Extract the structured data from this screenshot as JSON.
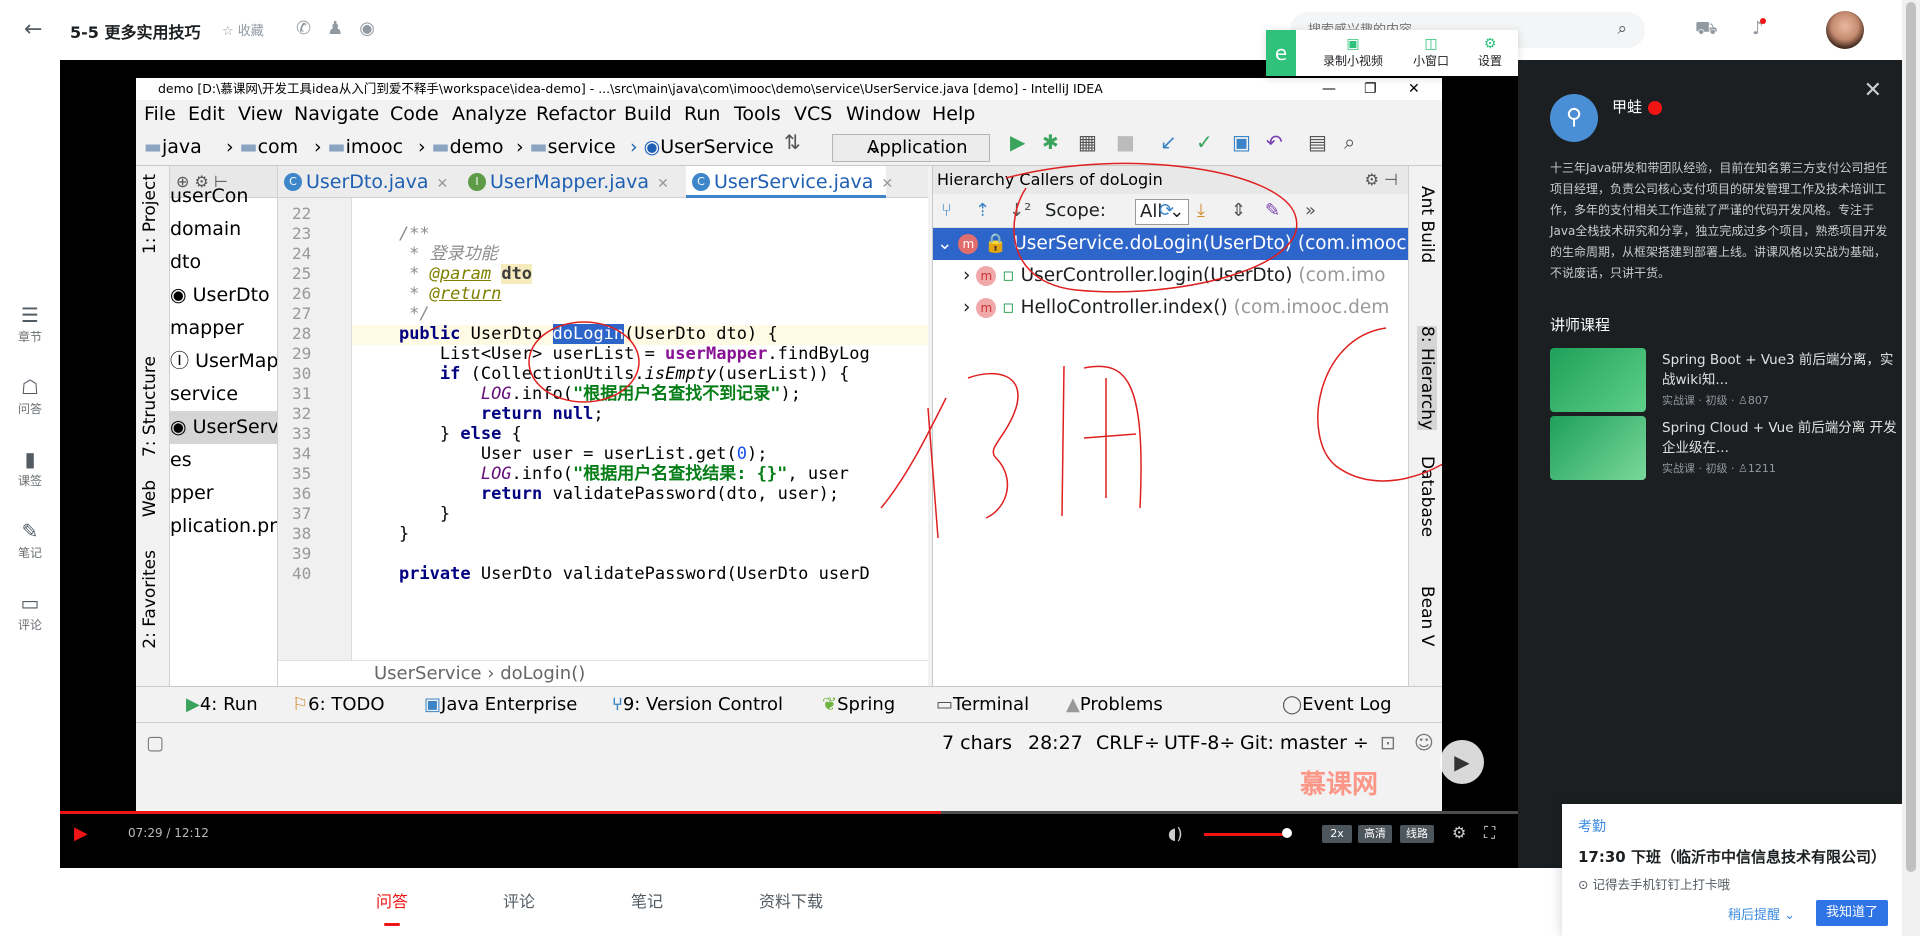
{
  "header": {
    "title": "5-5 更多实用技巧",
    "collect": "收藏",
    "search_placeholder": "搜索感兴趣的内容"
  },
  "tool_popup": {
    "record": "录制小视频",
    "mini": "小窗口",
    "settings": "设置"
  },
  "left_nav": [
    {
      "label": "章节",
      "icon": "chapters-icon"
    },
    {
      "label": "问答",
      "icon": "qa-icon"
    },
    {
      "label": "课签",
      "icon": "bookmark-icon"
    },
    {
      "label": "笔记",
      "icon": "notes-icon"
    },
    {
      "label": "评论",
      "icon": "comment-icon"
    }
  ],
  "ide": {
    "window_title": "demo [D:\\慕课网\\开发工具idea从入门到爱不释手\\workspace\\idea-demo] - ...\\src\\main\\java\\com\\imooc\\demo\\service\\UserService.java [demo] - IntelliJ IDEA",
    "menu": [
      "File",
      "Edit",
      "View",
      "Navigate",
      "Code",
      "Analyze",
      "Refactor",
      "Build",
      "Run",
      "Tools",
      "VCS",
      "Window",
      "Help"
    ],
    "breadcrumb": [
      "java",
      "com",
      "imooc",
      "demo",
      "service",
      "UserService"
    ],
    "run_config": "Application",
    "left_tools": [
      "1: Project",
      "7: Structure",
      "Web",
      "2: Favorites"
    ],
    "project_tree": [
      "userCon",
      "domain",
      "dto",
      "UserDto",
      "mapper",
      "UserMap",
      "service",
      "UserServ",
      "es",
      "pper",
      "plication.prop"
    ],
    "tabs": [
      {
        "label": "UserDto.java"
      },
      {
        "label": "UserMapper.java"
      },
      {
        "label": "UserService.java"
      }
    ],
    "code_lines": [
      "22",
      "23",
      "24",
      "25",
      "26",
      "27",
      "28",
      "29",
      "30",
      "31",
      "32",
      "33",
      "34",
      "35",
      "36",
      "37",
      "38",
      "39",
      "40"
    ],
    "code_breadcrumb": "UserService  ›  doLogin()",
    "hierarchy": {
      "title": "Hierarchy Callers of doLogin",
      "scope_label": "Scope:",
      "scope_value": "All",
      "rows": [
        {
          "method": "UserService.doLogin(UserDto)",
          "pkg": "(com.imooc"
        },
        {
          "method": "UserController.login(UserDto)",
          "pkg": "(com.imo"
        },
        {
          "method": "HelloController.index()",
          "pkg": "(com.imooc.dem"
        }
      ]
    },
    "right_tools": [
      "Ant Build",
      "8: Hierarchy",
      "Database",
      "Bean V"
    ],
    "bottom_tools": [
      "4: Run",
      "6: TODO",
      "Java Enterprise",
      "9: Version Control",
      "Spring",
      "Terminal",
      "Problems",
      "Event Log"
    ],
    "status": {
      "chars": "7 chars",
      "pos": "28:27",
      "crlf": "CRLF÷",
      "enc": "UTF-8÷",
      "git": "Git: master ÷"
    },
    "handwriting": "调用"
  },
  "watermark": "慕课网",
  "player": {
    "time": "07:29 / 12:12",
    "progress": 0.613,
    "speed": "2x",
    "quality": "高清",
    "line": "线路"
  },
  "teacher": {
    "name": "甲蛙",
    "bio": "十三年Java研发和带团队经验，目前在知名第三方支付公司担任项目经理，负责公司核心支付项目的研发管理工作及技术培训工作，多年的支付相关工作造就了严谨的代码开发风格。专注于Java全栈技术研究和分享，独立完成过多个项目，熟悉项目开发的生命周期，从框架搭建到部署上线。讲课风格以实战为基础，不说废话，只讲干货。"
  },
  "courses_heading": "讲师课程",
  "courses": [
    {
      "title": "Spring Boot + Vue3 前后端分离，实战wiki知...",
      "meta": "实战课 · 初级 · ♙807"
    },
    {
      "title": "Spring Cloud + Vue 前后端分离 开发企业级在...",
      "meta": "实战课 · 初级 · ♙1211"
    }
  ],
  "bottom_tabs": [
    "问答",
    "评论",
    "笔记",
    "资料下载"
  ],
  "notification": {
    "title": "考勤",
    "main": "17:30 下班（临沂市中信信息技术有限公司）",
    "sub": "记得去手机钉钉上打卡哦",
    "later": "稍后提醒",
    "ok": "我知道了"
  }
}
